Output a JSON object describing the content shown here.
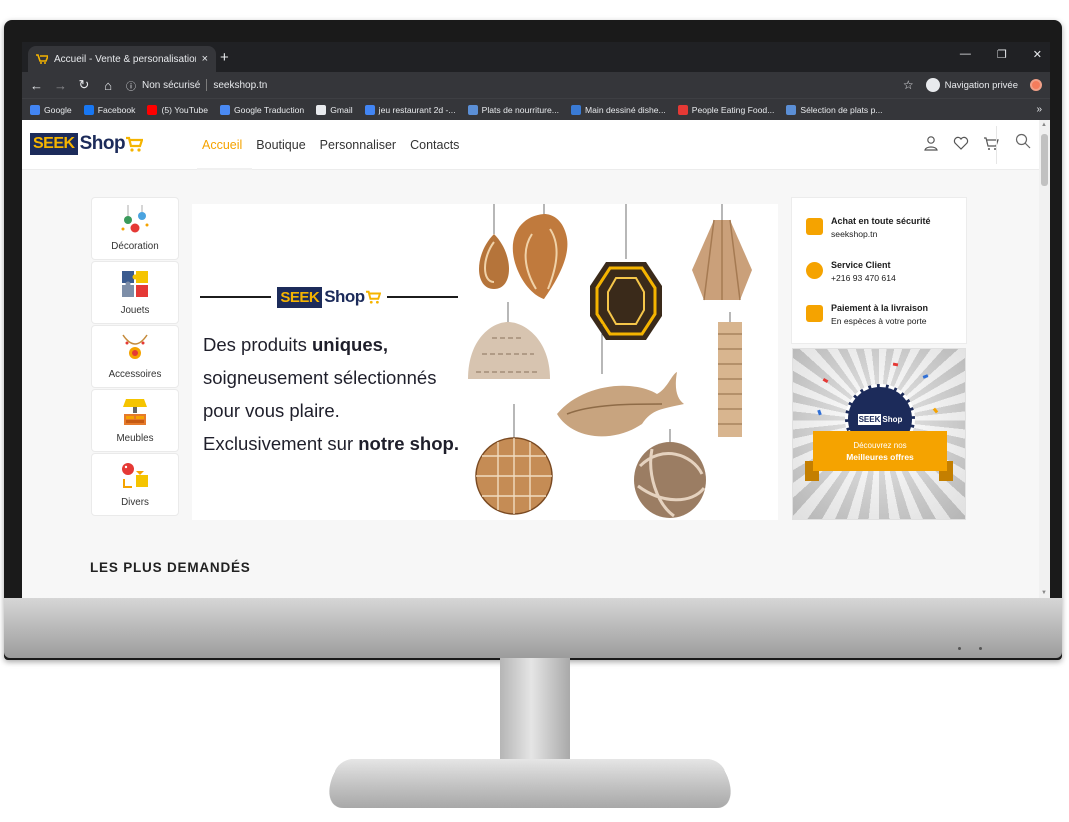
{
  "browser": {
    "tab_title": "Accueil - Vente & personalisation",
    "tab_close": "×",
    "new_tab": "+",
    "win_minimize": "—",
    "win_restore": "❐",
    "win_close": "✕",
    "security_label": "Non sécurisé",
    "url": "seekshop.tn",
    "private_label": "Navigation privée",
    "bookmarks": [
      {
        "label": "Google",
        "color": "#4285f4"
      },
      {
        "label": "Facebook",
        "color": "#1877f2"
      },
      {
        "label": "(5) YouTube",
        "color": "#ff0000"
      },
      {
        "label": "Google Traduction",
        "color": "#4a8af4"
      },
      {
        "label": "Gmail",
        "color": "#e8eaed"
      },
      {
        "label": "jeu restaurant 2d -...",
        "color": "#4285f4"
      },
      {
        "label": "Plats de nourriture...",
        "color": "#5b8fd6"
      },
      {
        "label": "Main dessiné dishe...",
        "color": "#3a7bd5"
      },
      {
        "label": "People Eating Food...",
        "color": "#e53935"
      },
      {
        "label": "Sélection de plats p...",
        "color": "#5b8fd6"
      }
    ],
    "bookmarks_more": "»"
  },
  "site": {
    "logo_seek": "SEEK",
    "logo_shop": "Shop",
    "nav": [
      "Accueil",
      "Boutique",
      "Personnaliser",
      "Contacts"
    ],
    "categories": [
      "Décoration",
      "Jouets",
      "Accessoires",
      "Meubles",
      "Divers"
    ],
    "banner": {
      "line1_pre": "Des produits ",
      "line1_bold": "uniques,",
      "line2": "soigneusement sélectionnés",
      "line3": "pour vous plaire.",
      "line4_pre": "Exclusivement sur ",
      "line4_bold": "notre shop."
    },
    "info": [
      {
        "title": "Achat en toute sécurité",
        "sub": "seekshop.tn"
      },
      {
        "title": "Service Client",
        "sub": "+216 93 470 614"
      },
      {
        "title": "Paiement à la livraison",
        "sub": "En espèces à votre porte"
      }
    ],
    "promo": {
      "line1": "Découvrez nos",
      "line2": "Meilleures offres"
    },
    "section_title": "LES PLUS DEMANDÉS"
  },
  "colors": {
    "accent": "#f5a300",
    "brand_navy": "#1c2b5a",
    "chrome_dark": "#35363a"
  }
}
